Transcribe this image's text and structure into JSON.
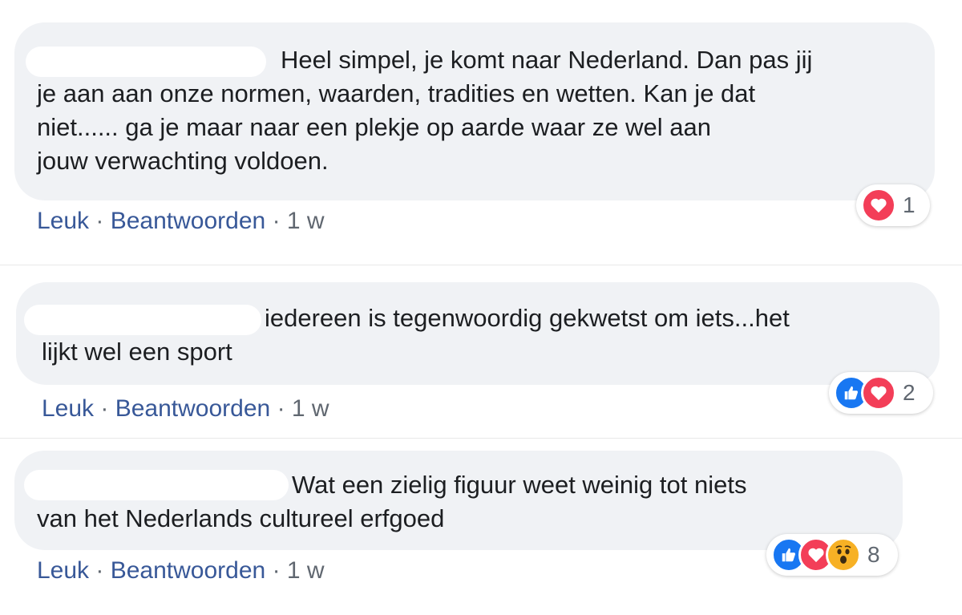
{
  "comments": [
    {
      "text": "Heel simpel, je komt naar Nederland. Dan pas jij\nje aan aan onze normen, waarden, tradities en wetten. Kan je dat\nniet...... ga je maar naar een plekje op aarde waar ze wel aan\njouw verwachting voldoen.",
      "like_label": "Leuk",
      "reply_label": "Beantwoorden",
      "separator": "·",
      "time": "1 w",
      "reaction_icons": [
        "love-icon"
      ],
      "reaction_count": "1"
    },
    {
      "text": "iedereen is tegenwoordig gekwetst om iets...het\nlijkt wel een sport",
      "like_label": "Leuk",
      "reply_label": "Beantwoorden",
      "separator": "·",
      "time": "1 w",
      "reaction_icons": [
        "like-icon",
        "love-icon"
      ],
      "reaction_count": "2"
    },
    {
      "text": "Wat een zielig figuur weet weinig tot niets\nvan het Nederlands cultureel erfgoed",
      "like_label": "Leuk",
      "reply_label": "Beantwoorden",
      "separator": "·",
      "time": "1 w",
      "reaction_icons": [
        "like-icon",
        "love-icon",
        "wow-icon"
      ],
      "reaction_count": "8"
    }
  ],
  "colors": {
    "bubble": "#f0f2f5",
    "link": "#385898",
    "like_blue": "#1877f2",
    "love_red": "#f33e58",
    "wow_yellow": "#f7b125"
  }
}
